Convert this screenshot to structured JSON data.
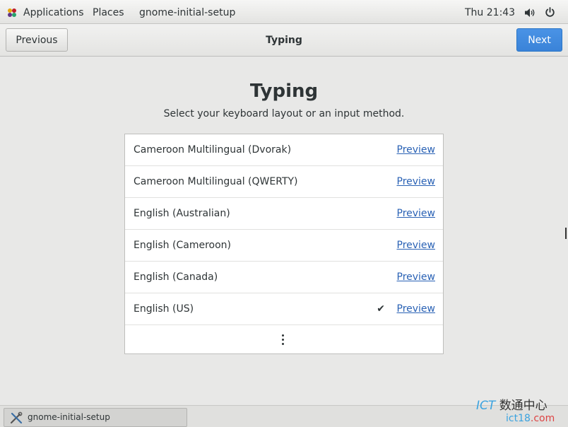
{
  "top_panel": {
    "applications": "Applications",
    "places": "Places",
    "app_name": "gnome-initial-setup",
    "clock": "Thu 21:43",
    "icons": [
      "applications-icon",
      "volume-icon",
      "power-icon"
    ]
  },
  "header": {
    "previous_label": "Previous",
    "title": "Typing",
    "next_label": "Next"
  },
  "main": {
    "heading": "Typing",
    "subtitle": "Select your keyboard layout or an input method.",
    "preview_label": "Preview",
    "layouts": [
      {
        "name": "Cameroon Multilingual (Dvorak)",
        "selected": false
      },
      {
        "name": "Cameroon Multilingual (QWERTY)",
        "selected": false
      },
      {
        "name": "English (Australian)",
        "selected": false
      },
      {
        "name": "English (Cameroon)",
        "selected": false
      },
      {
        "name": "English (Canada)",
        "selected": false
      },
      {
        "name": "English (US)",
        "selected": true
      }
    ],
    "check_mark": "✔"
  },
  "taskbar": {
    "window_label": "gnome-initial-setup"
  },
  "watermark": {
    "brand_latin": "ICT",
    "brand_cn": "数通中心",
    "domain_a": "ict18",
    "domain_b": ".com"
  },
  "colors": {
    "accent": "#3a83d8",
    "link": "#2a62b5"
  }
}
